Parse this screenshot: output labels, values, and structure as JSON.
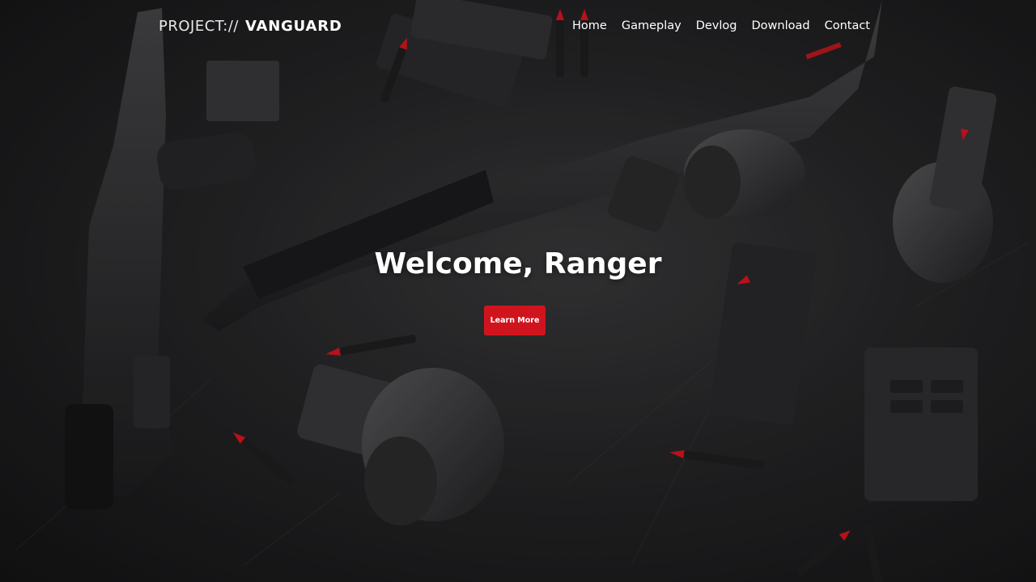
{
  "brand": {
    "prefix": "PROJECT://",
    "name": "VANGUARD"
  },
  "nav": {
    "items": [
      {
        "label": "Home"
      },
      {
        "label": "Gameplay"
      },
      {
        "label": "Devlog"
      },
      {
        "label": "Download"
      },
      {
        "label": "Contact"
      }
    ]
  },
  "hero": {
    "headline": "Welcome, Ranger",
    "cta_label": "Learn More",
    "background": "hero-weapons-image"
  },
  "colors": {
    "accent": "#d0141e",
    "background": "#1f1f21",
    "text": "#ffffff",
    "bullet_tip": "#e0151f"
  }
}
